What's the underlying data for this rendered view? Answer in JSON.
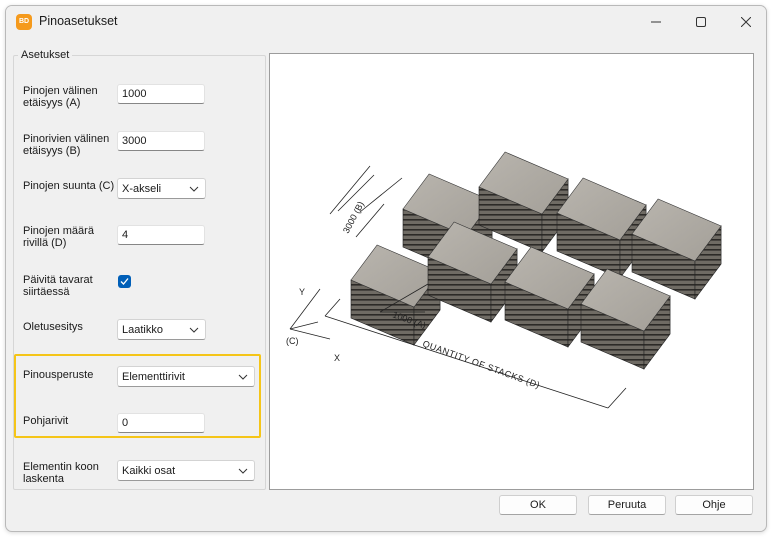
{
  "window": {
    "title": "Pinoasetukset",
    "app_icon_text": "BD"
  },
  "settings": {
    "group_title": "Asetukset",
    "stack_spacing": {
      "label": "Pinojen välinen\netäisyys (A)",
      "value": "1000"
    },
    "row_spacing": {
      "label": "Pinorivien välinen\netäisyys (B)",
      "value": "3000"
    },
    "direction": {
      "label": "Pinojen suunta (C)",
      "value": "X-akseli"
    },
    "stacks_per_row": {
      "label": "Pinojen määrä\nrivillä (D)",
      "value": "4"
    },
    "update_goods": {
      "label": "Päivitä tavarat\nsiirtäessä",
      "checked": true
    },
    "default_view": {
      "label": "Oletusesitys",
      "value": "Laatikko"
    },
    "stack_basis": {
      "label": "Pinousperuste",
      "value": "Elementtirivit"
    },
    "base_rows": {
      "label": "Pohjarivit",
      "value": "0"
    },
    "size_calc": {
      "label": "Elementin koon\nlaskenta",
      "value": "Kaikki osat"
    }
  },
  "preview": {
    "dim_b": "3000 (B)",
    "dim_a": "1000 (A)",
    "dim_d": "QUANTITY OF STACKS (D)",
    "axis_y": "Y",
    "axis_x": "X",
    "axis_c": "(C)"
  },
  "buttons": {
    "ok": "OK",
    "cancel": "Peruuta",
    "help": "Ohje"
  },
  "colors": {
    "highlight": "#f5c518",
    "accent": "#005fb8"
  }
}
